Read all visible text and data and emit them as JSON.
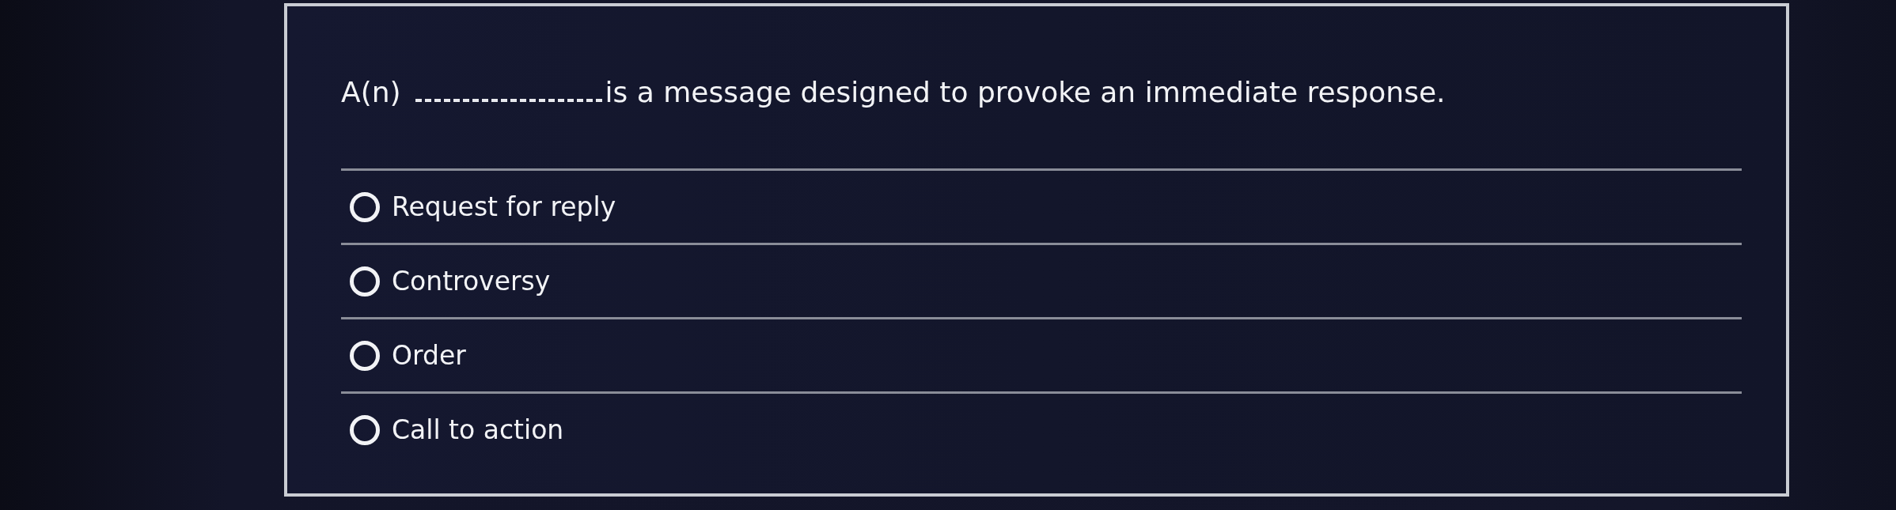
{
  "question": {
    "prefix": "A(n)",
    "text": "is a message designed to provoke an immediate response."
  },
  "options": [
    {
      "label": "Request for reply",
      "selected": false
    },
    {
      "label": "Controversy",
      "selected": false
    },
    {
      "label": "Order",
      "selected": false
    },
    {
      "label": "Call to action",
      "selected": false
    }
  ]
}
